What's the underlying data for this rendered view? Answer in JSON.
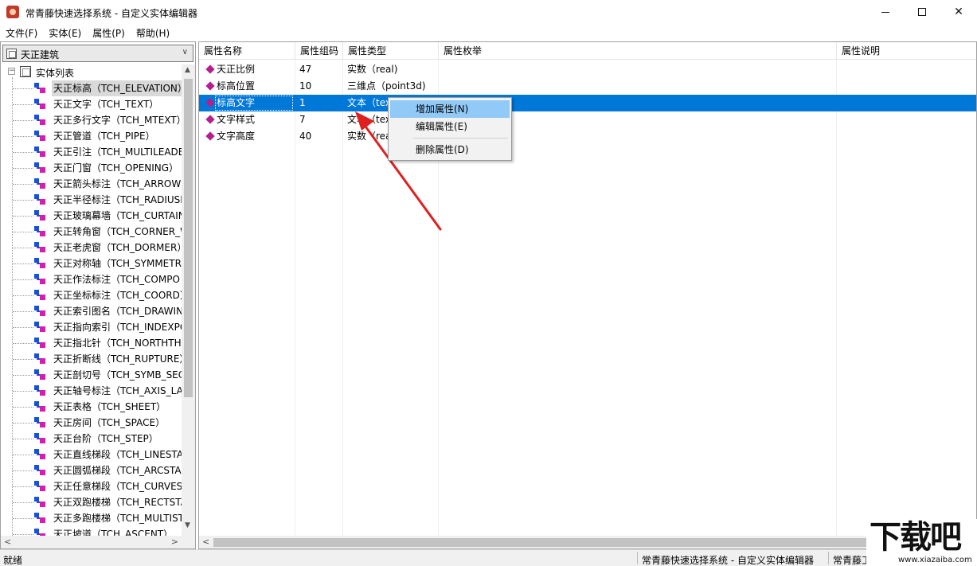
{
  "window": {
    "title": "常青藤快速选择系统 - 自定义实体编辑器",
    "min_label": "—",
    "max_label": "□",
    "close_label": "✕"
  },
  "menu": [
    {
      "label": "文件(F)"
    },
    {
      "label": "实体(E)"
    },
    {
      "label": "属性(P)"
    },
    {
      "label": "帮助(H)"
    }
  ],
  "left": {
    "combo_value": "天正建筑",
    "combo_arrow": "∨",
    "root_expander": "−",
    "root_label": "实体列表",
    "entities": [
      "天正标高（TCH_ELEVATION）",
      "天正文字（TCH_TEXT）",
      "天正多行文字（TCH_MTEXT）",
      "天正管道（TCH_PIPE）",
      "天正引注（TCH_MULTILEADE",
      "天正门窗（TCH_OPENING）",
      "天正箭头标注（TCH_ARROW）",
      "天正半径标注（TCH_RADIUSD",
      "天正玻璃幕墙（TCH_CURTAIN",
      "天正转角窗（TCH_CORNER_W",
      "天正老虎窗（TCH_DORMER）",
      "天正对称轴（TCH_SYMMETR",
      "天正作法标注（TCH_COMPO",
      "天正坐标标注（TCH_COORD）",
      "天正索引图名（TCH_DRAWIN",
      "天正指向索引（TCH_INDEXPO",
      "天正指北针（TCH_NORTHTH",
      "天正折断线（TCH_RUPTURE）",
      "天正剖切号（TCH_SYMB_SEC",
      "天正轴号标注（TCH_AXIS_LAI",
      "天正表格（TCH_SHEET）",
      "天正房间（TCH_SPACE）",
      "天正台阶（TCH_STEP）",
      "天正直线梯段（TCH_LINESTA",
      "天正圆弧梯段（TCH_ARCSTAI",
      "天正任意梯段（TCH_CURVEST",
      "天正双跑楼梯（TCH_RECTSTA",
      "天正多跑楼梯（TCH_MULTIST",
      "天正坡道（TCH_ASCENT）"
    ],
    "scroll_up": "▲",
    "scroll_down": "▼",
    "scroll_left": "<",
    "scroll_right": ">"
  },
  "grid": {
    "columns": [
      "属性名称",
      "属性组码",
      "属性类型",
      "属性枚举",
      "属性说明"
    ],
    "rows": [
      {
        "name": "天正比例",
        "code": "47",
        "type": "实数（real)"
      },
      {
        "name": "标高位置",
        "code": "10",
        "type": "三维点（point3d)"
      },
      {
        "name": "标高文字",
        "code": "1",
        "type": "文本（tex"
      },
      {
        "name": "文字样式",
        "code": "7",
        "type": "文本（tex"
      },
      {
        "name": "文字高度",
        "code": "40",
        "type": "实数（rea"
      }
    ],
    "scroll_left": "<"
  },
  "context_menu": {
    "items": [
      "增加属性(N)",
      "编辑属性(E)",
      "删除属性(D)"
    ]
  },
  "status": {
    "left": "就绪",
    "middle": "常青藤快速选择系统 - 自定义实体编辑器",
    "right": "常青藤工"
  },
  "watermark": {
    "text": "下载吧",
    "url": "www.xiazaiba.com"
  },
  "colors": {
    "selection": "#0078d7",
    "menu_hover": "#91c9f7",
    "diamond": "#b51e8f",
    "arrow": "#e02020"
  }
}
